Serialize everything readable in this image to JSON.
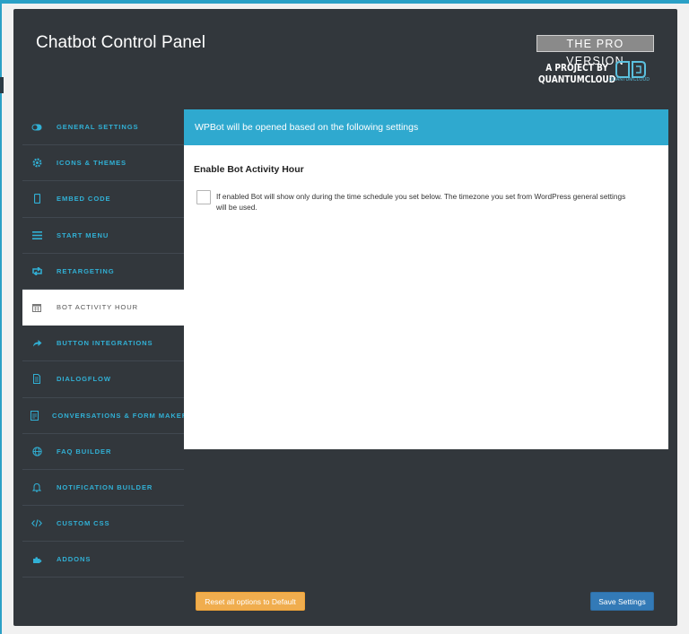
{
  "header": {
    "title": "Chatbot Control Panel",
    "pro_badge": "THE PRO VERSION",
    "project_by_line1": "A PROJECT BY",
    "project_by_line2": "QUANTUMCLOUD",
    "logo_caption": "QUANTUMCLOUD"
  },
  "sidebar": {
    "items": [
      {
        "label": "GENERAL SETTINGS",
        "icon": "toggle-icon"
      },
      {
        "label": "ICONS & THEMES",
        "icon": "gear-icon"
      },
      {
        "label": "EMBED CODE",
        "icon": "mobile-icon"
      },
      {
        "label": "START MENU",
        "icon": "menu-icon"
      },
      {
        "label": "RETARGETING",
        "icon": "retweet-icon"
      },
      {
        "label": "BOT ACTIVITY HOUR",
        "icon": "calendar-icon"
      },
      {
        "label": "BUTTON INTEGRATIONS",
        "icon": "share-icon"
      },
      {
        "label": "DIALOGFLOW",
        "icon": "file-icon"
      },
      {
        "label": "CONVERSATIONS & FORM MAKER",
        "icon": "form-icon"
      },
      {
        "label": "FAQ BUILDER",
        "icon": "globe-icon"
      },
      {
        "label": "NOTIFICATION BUILDER",
        "icon": "bell-icon"
      },
      {
        "label": "CUSTOM CSS",
        "icon": "code-icon"
      },
      {
        "label": "ADDONS",
        "icon": "puzzle-icon"
      }
    ],
    "active_index": 5
  },
  "content": {
    "header": "WPBot will be opened based on the following settings",
    "section_title": "Enable Bot Activity Hour",
    "checkbox_desc": "If enabled Bot will show only during the time schedule you set below. The timezone you set from WordPress general settings will be used.",
    "checkbox_checked": false
  },
  "footer": {
    "reset_label": "Reset all options to Default",
    "save_label": "Save Settings"
  },
  "colors": {
    "panel_bg": "#32373c",
    "accent": "#2fa9cf",
    "reset_button": "#f0ad4e",
    "save_button": "#337ab7"
  }
}
